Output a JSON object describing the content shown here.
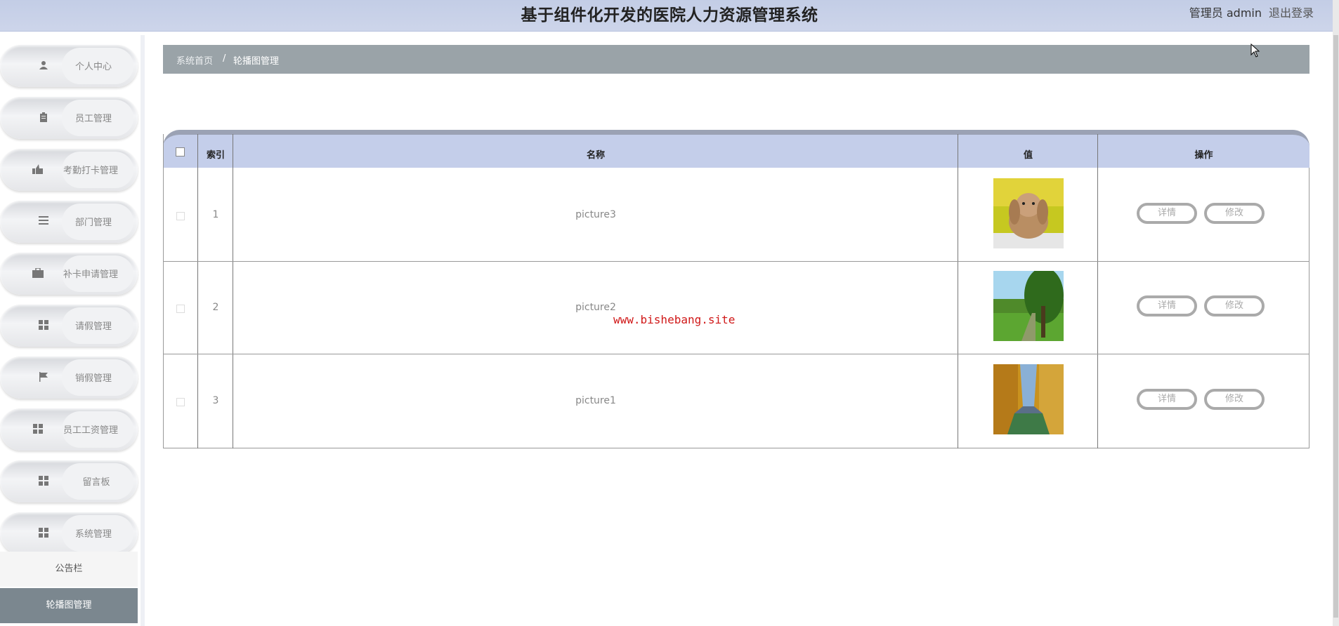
{
  "header": {
    "title": "基于组件化开发的医院人力资源管理系统",
    "user": "管理员 admin",
    "logout": "退出登录"
  },
  "sidebar": {
    "items": [
      {
        "label": "个人中心",
        "icon": "user-icon"
      },
      {
        "label": "员工管理",
        "icon": "clipboard-icon"
      },
      {
        "label": "考勤打卡管理",
        "icon": "thumbs-up-icon"
      },
      {
        "label": "部门管理",
        "icon": "list-icon"
      },
      {
        "label": "补卡申请管理",
        "icon": "briefcase-icon"
      },
      {
        "label": "请假管理",
        "icon": "grid-icon"
      },
      {
        "label": "销假管理",
        "icon": "flag-icon"
      },
      {
        "label": "员工工资管理",
        "icon": "grid-icon"
      },
      {
        "label": "留言板",
        "icon": "grid-icon"
      },
      {
        "label": "系统管理",
        "icon": "grid-icon"
      }
    ],
    "sub_items": [
      {
        "label": "公告栏",
        "active": false
      },
      {
        "label": "轮播图管理",
        "active": true
      }
    ]
  },
  "breadcrumb": {
    "home": "系统首页",
    "separator": "/",
    "current": "轮播图管理"
  },
  "table": {
    "headers": {
      "index": "索引",
      "name": "名称",
      "value": "值",
      "actions": "操作"
    },
    "rows": [
      {
        "index": "1",
        "name": "picture3",
        "image": "rabbit-photo"
      },
      {
        "index": "2",
        "name": "picture2",
        "image": "willow-tree-photo"
      },
      {
        "index": "3",
        "name": "picture1",
        "image": "autumn-forest-photo"
      }
    ],
    "detail_label": "详情",
    "edit_label": "修改"
  },
  "watermark": "www.bishebang.site",
  "colors": {
    "header_bg": "#c3cde6",
    "table_header_bg": "#c4ceea",
    "breadcrumb_bg": "#9aa3a8",
    "active_menu_bg": "#7b878f",
    "watermark": "#d01818"
  }
}
